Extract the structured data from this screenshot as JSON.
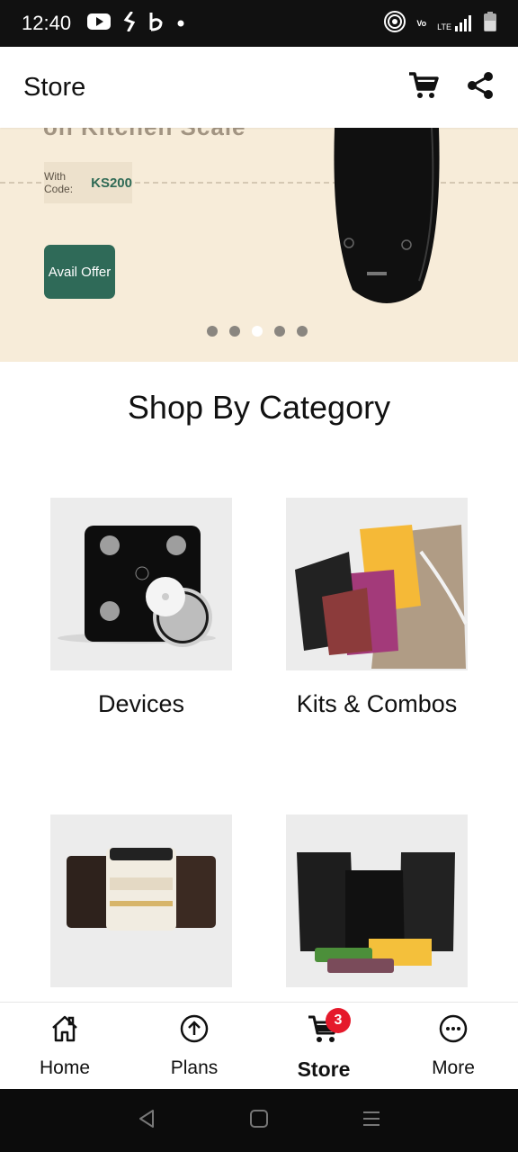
{
  "status_bar": {
    "time": "12:40",
    "lte_label": "LTE",
    "volte_label": "Vo"
  },
  "header": {
    "title": "Store"
  },
  "banner": {
    "partial_heading": "on Kitchen Scale",
    "code_label": "With Code:",
    "code_value": "KS200",
    "cta_label": "Avail Offer",
    "active_slide": 3,
    "slide_count": 5
  },
  "section": {
    "title": "Shop By Category"
  },
  "categories": [
    {
      "label": "Devices"
    },
    {
      "label": "Kits & Combos"
    },
    {
      "label": ""
    },
    {
      "label": ""
    }
  ],
  "bottom_nav": {
    "items": [
      {
        "label": "Home",
        "icon": "home-icon"
      },
      {
        "label": "Plans",
        "icon": "arrow-up-circle-icon"
      },
      {
        "label": "Store",
        "icon": "cart-icon",
        "badge": "3"
      },
      {
        "label": "More",
        "icon": "more-dots-icon"
      }
    ]
  },
  "colors": {
    "accent": "#2f6a58",
    "badge": "#e5192b",
    "banner_bg": "#f7ecd9"
  }
}
